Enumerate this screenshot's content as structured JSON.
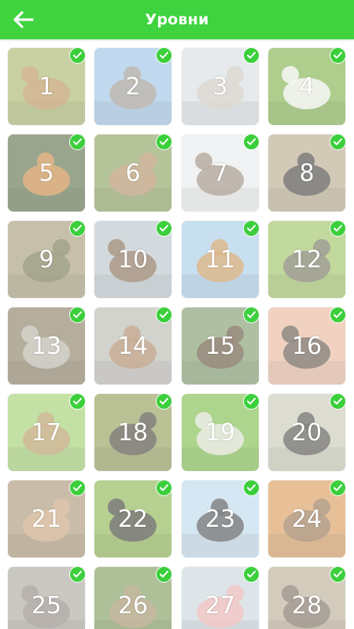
{
  "header": {
    "title": "Уровни",
    "back_icon": "arrow-left-icon",
    "background": "#3fd33f"
  },
  "levels": [
    {
      "number": "1",
      "animal": "hare",
      "completed": true,
      "colors": [
        "#a9b36a",
        "#b98a52"
      ]
    },
    {
      "number": "2",
      "animal": "elephant",
      "completed": true,
      "colors": [
        "#9cc2e4",
        "#9a8f84"
      ]
    },
    {
      "number": "3",
      "animal": "seal",
      "completed": true,
      "colors": [
        "#d7dde1",
        "#c9c2b6"
      ]
    },
    {
      "number": "4",
      "animal": "stork",
      "completed": true,
      "colors": [
        "#7fb04a",
        "#f3f3f3"
      ]
    },
    {
      "number": "5",
      "animal": "tiger",
      "completed": true,
      "colors": [
        "#5c6e49",
        "#d48a3c"
      ]
    },
    {
      "number": "6",
      "animal": "kangaroo",
      "completed": true,
      "colors": [
        "#8aa15c",
        "#b48a64"
      ]
    },
    {
      "number": "7",
      "animal": "wolf",
      "completed": true,
      "colors": [
        "#e9eaec",
        "#8c7b68"
      ]
    },
    {
      "number": "8",
      "animal": "zebra",
      "completed": true,
      "colors": [
        "#b8a88c",
        "#2f2f2f"
      ]
    },
    {
      "number": "9",
      "animal": "crocodile",
      "completed": true,
      "colors": [
        "#a39a76",
        "#6b6a44"
      ]
    },
    {
      "number": "10",
      "animal": "woodpecker",
      "completed": true,
      "colors": [
        "#b9c4c8",
        "#7a5c40"
      ]
    },
    {
      "number": "11",
      "animal": "giraffe",
      "completed": true,
      "colors": [
        "#a6cbe6",
        "#c98f47"
      ]
    },
    {
      "number": "12",
      "animal": "ostrich",
      "completed": true,
      "colors": [
        "#9bc25f",
        "#6b6358"
      ]
    },
    {
      "number": "13",
      "animal": "lemur",
      "completed": true,
      "colors": [
        "#8a7d62",
        "#b9b6ad"
      ]
    },
    {
      "number": "14",
      "animal": "monkey",
      "completed": true,
      "colors": [
        "#b9b8b0",
        "#a87c57"
      ]
    },
    {
      "number": "15",
      "animal": "bear",
      "completed": true,
      "colors": [
        "#7e9a6a",
        "#5a4430"
      ]
    },
    {
      "number": "16",
      "animal": "vulture",
      "completed": true,
      "colors": [
        "#e9b79c",
        "#4a4238"
      ]
    },
    {
      "number": "17",
      "animal": "gopher",
      "completed": true,
      "colors": [
        "#9fcf6d",
        "#b58e5c"
      ]
    },
    {
      "number": "18",
      "animal": "tasmanian-devil",
      "completed": true,
      "colors": [
        "#8e9b55",
        "#3c3630"
      ]
    },
    {
      "number": "19",
      "animal": "goose",
      "completed": true,
      "colors": [
        "#7cbc48",
        "#e2e0d8"
      ]
    },
    {
      "number": "20",
      "animal": "buffalo",
      "completed": true,
      "colors": [
        "#c7c8b4",
        "#3d3a36"
      ]
    },
    {
      "number": "21",
      "animal": "lynx",
      "completed": true,
      "colors": [
        "#a99473",
        "#caa379"
      ]
    },
    {
      "number": "22",
      "animal": "skunk",
      "completed": true,
      "colors": [
        "#89b44e",
        "#2f2d2b"
      ]
    },
    {
      "number": "23",
      "animal": "penguin",
      "completed": true,
      "colors": [
        "#bcd8ea",
        "#3a3a3a"
      ]
    },
    {
      "number": "24",
      "animal": "hedgehog",
      "completed": true,
      "colors": [
        "#d89a5a",
        "#8a6a4a"
      ]
    },
    {
      "number": "25",
      "animal": "hippo",
      "completed": true,
      "colors": [
        "#a9a79c",
        "#8a7f7a"
      ]
    },
    {
      "number": "26",
      "animal": "hyena",
      "completed": true,
      "colors": [
        "#7c9a58",
        "#a58c66"
      ]
    },
    {
      "number": "27",
      "animal": "flamingo",
      "completed": true,
      "colors": [
        "#c9d6dc",
        "#e9a7a4"
      ]
    },
    {
      "number": "28",
      "animal": "porcupine",
      "completed": true,
      "colors": [
        "#b9ac93",
        "#6e6254"
      ]
    }
  ],
  "check_icon": "check-icon",
  "check_color": "#3ccf3c"
}
